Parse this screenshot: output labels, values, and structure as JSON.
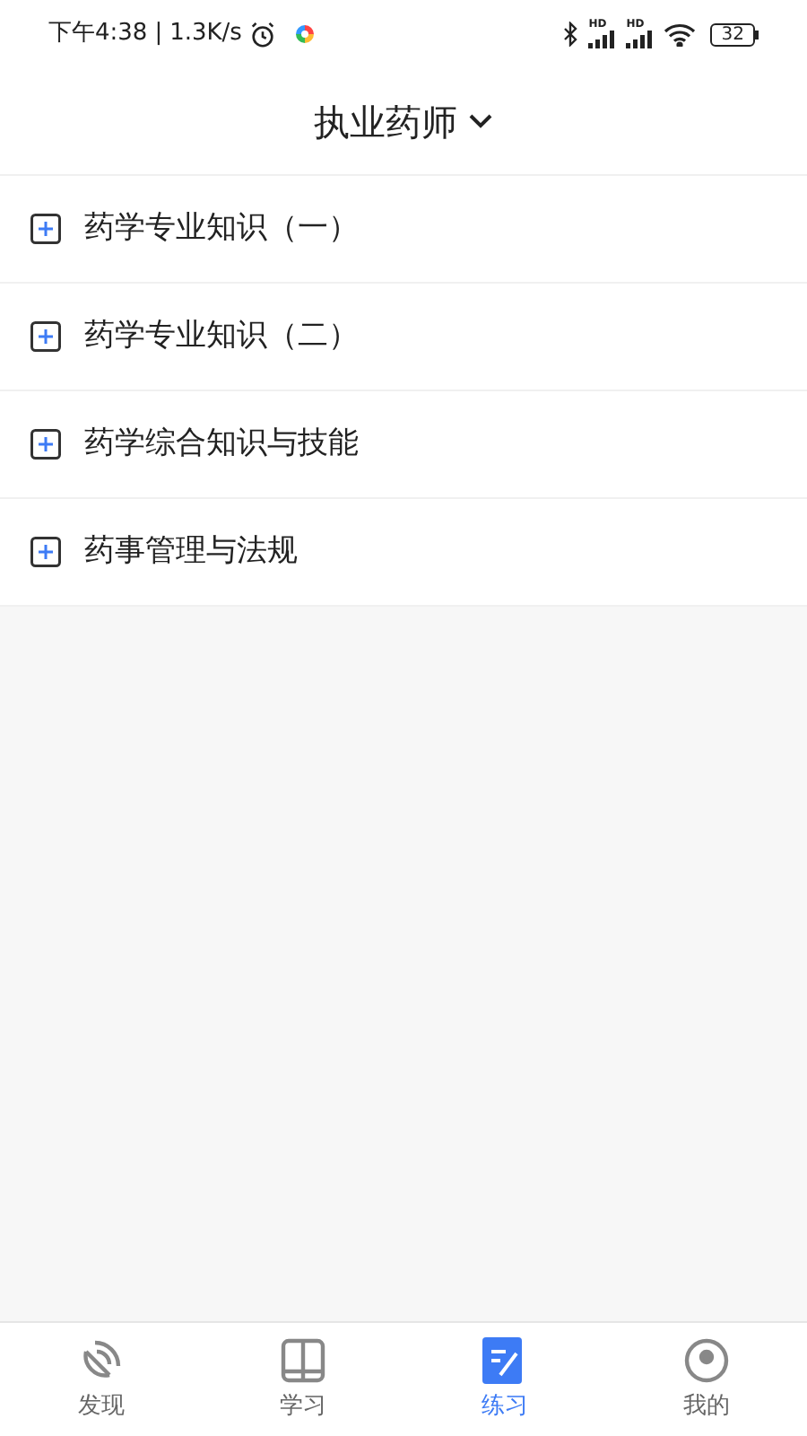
{
  "status_bar": {
    "time": "下午4:38",
    "separator": "|",
    "speed": "1.3K/s",
    "battery": "32",
    "signal_labels": [
      "HD",
      "HD"
    ]
  },
  "header": {
    "title": "执业药师"
  },
  "subjects": [
    {
      "label": "药学专业知识（一）"
    },
    {
      "label": "药学专业知识（二）"
    },
    {
      "label": "药学综合知识与技能"
    },
    {
      "label": "药事管理与法规"
    }
  ],
  "tab_bar": [
    {
      "label": "发现",
      "selected": false,
      "kind": "discover"
    },
    {
      "label": "学习",
      "selected": false,
      "kind": "study"
    },
    {
      "label": "练习",
      "selected": true,
      "kind": "practice"
    },
    {
      "label": "我的",
      "selected": false,
      "kind": "me"
    }
  ]
}
